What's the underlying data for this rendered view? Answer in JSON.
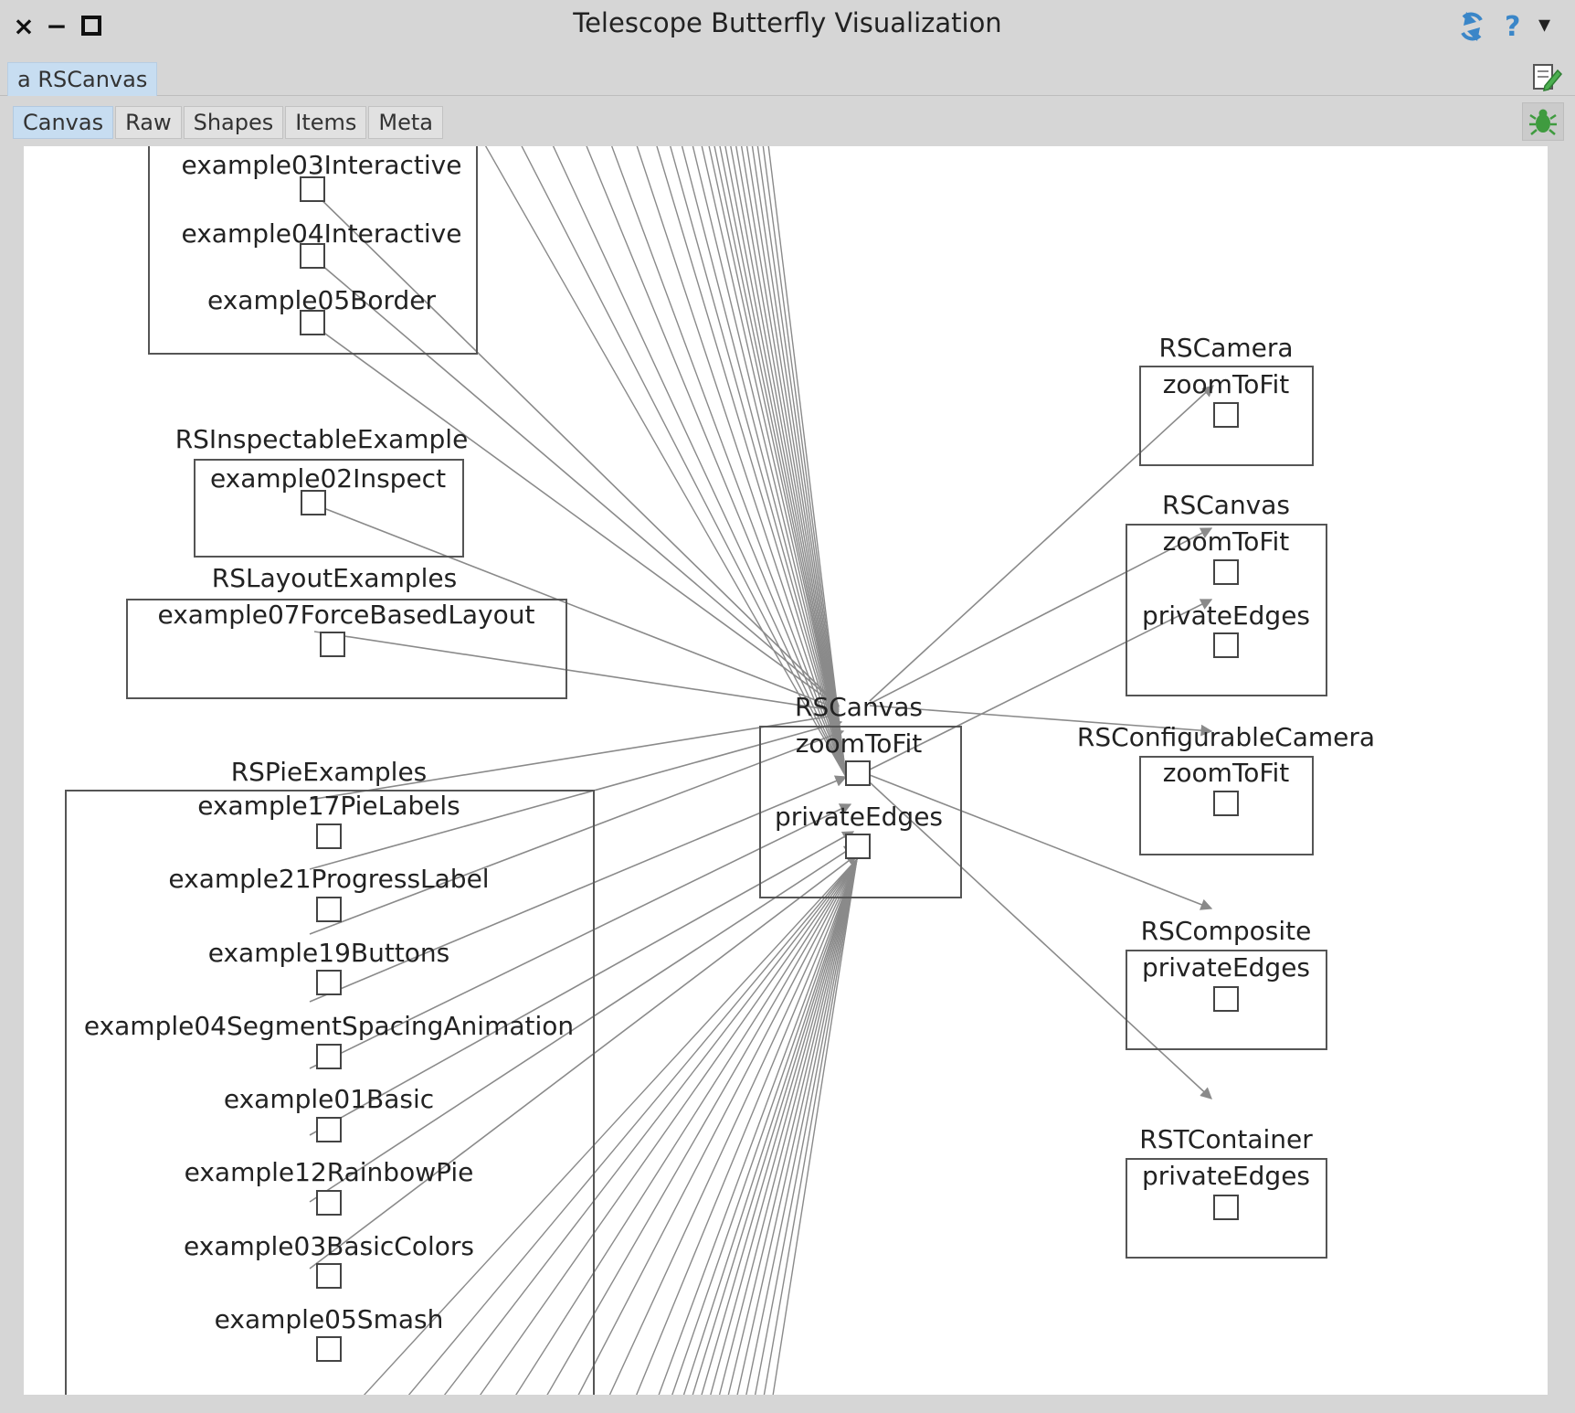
{
  "window": {
    "title": "Telescope Butterfly Visualization",
    "close_glyph": "×",
    "minimize_glyph": "−",
    "maximize_glyph": "□",
    "help_glyph": "?",
    "menu_glyph": "▾",
    "refresh_icon": "refresh-icon"
  },
  "presenter_tab": {
    "label": "a RSCanvas"
  },
  "tabs": [
    {
      "label": "Canvas",
      "active": true
    },
    {
      "label": "Raw",
      "active": false
    },
    {
      "label": "Shapes",
      "active": false
    },
    {
      "label": "Items",
      "active": false
    },
    {
      "label": "Meta",
      "active": false
    }
  ],
  "colors": {
    "edge": "#8a8a8a",
    "box": "#555555",
    "tab_active": "#c7ddf1",
    "bug": "#3f9b3f"
  },
  "graph": {
    "left_partial_box": {
      "methods": [
        "example03Interactive",
        "example04Interactive",
        "example05Border"
      ]
    },
    "inspectable": {
      "title": "RSInspectableExample",
      "methods": [
        "example02Inspect"
      ]
    },
    "layout_examples": {
      "title": "RSLayoutExamples",
      "methods": [
        "example07ForceBasedLayout"
      ]
    },
    "pie_examples": {
      "title": "RSPieExamples",
      "methods": [
        "example17PieLabels",
        "example21ProgressLabel",
        "example19Buttons",
        "example04SegmentSpacingAnimation",
        "example01Basic",
        "example12RainbowPie",
        "example03BasicColors",
        "example05Smash"
      ]
    },
    "center": {
      "title": "RSCanvas",
      "methods": [
        "zoomToFit",
        "privateEdges"
      ]
    },
    "right": [
      {
        "title": "RSCamera",
        "methods": [
          "zoomToFit"
        ]
      },
      {
        "title": "RSCanvas",
        "methods": [
          "zoomToFit",
          "privateEdges"
        ]
      },
      {
        "title": "RSConfigurableCamera",
        "methods": [
          "zoomToFit"
        ]
      },
      {
        "title": "RSComposite",
        "methods": [
          "privateEdges"
        ]
      },
      {
        "title": "RSTContainer",
        "methods": [
          "privateEdges"
        ]
      }
    ]
  }
}
